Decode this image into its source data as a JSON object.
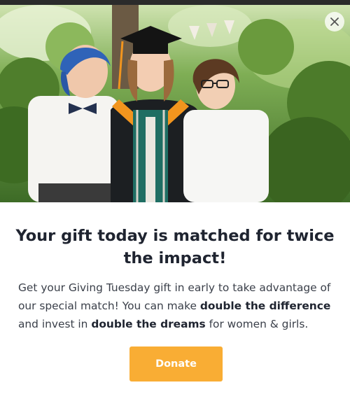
{
  "modal": {
    "hero_image": "photo of graduate in cap and gown with two children in a garden",
    "close_icon": "close-icon",
    "headline": "Your gift today is matched for twice the impact!",
    "body": {
      "part1": "Get your Giving Tuesday gift in early to take advantage of our special match! You can make ",
      "bold1": "double the difference",
      "part2": " and invest in ",
      "bold2": "double the dreams",
      "part3": " for women & girls."
    },
    "donate_label": "Donate"
  },
  "colors": {
    "accent": "#f9ad34",
    "headline": "#1f2430",
    "body_text": "#3a3f49"
  }
}
